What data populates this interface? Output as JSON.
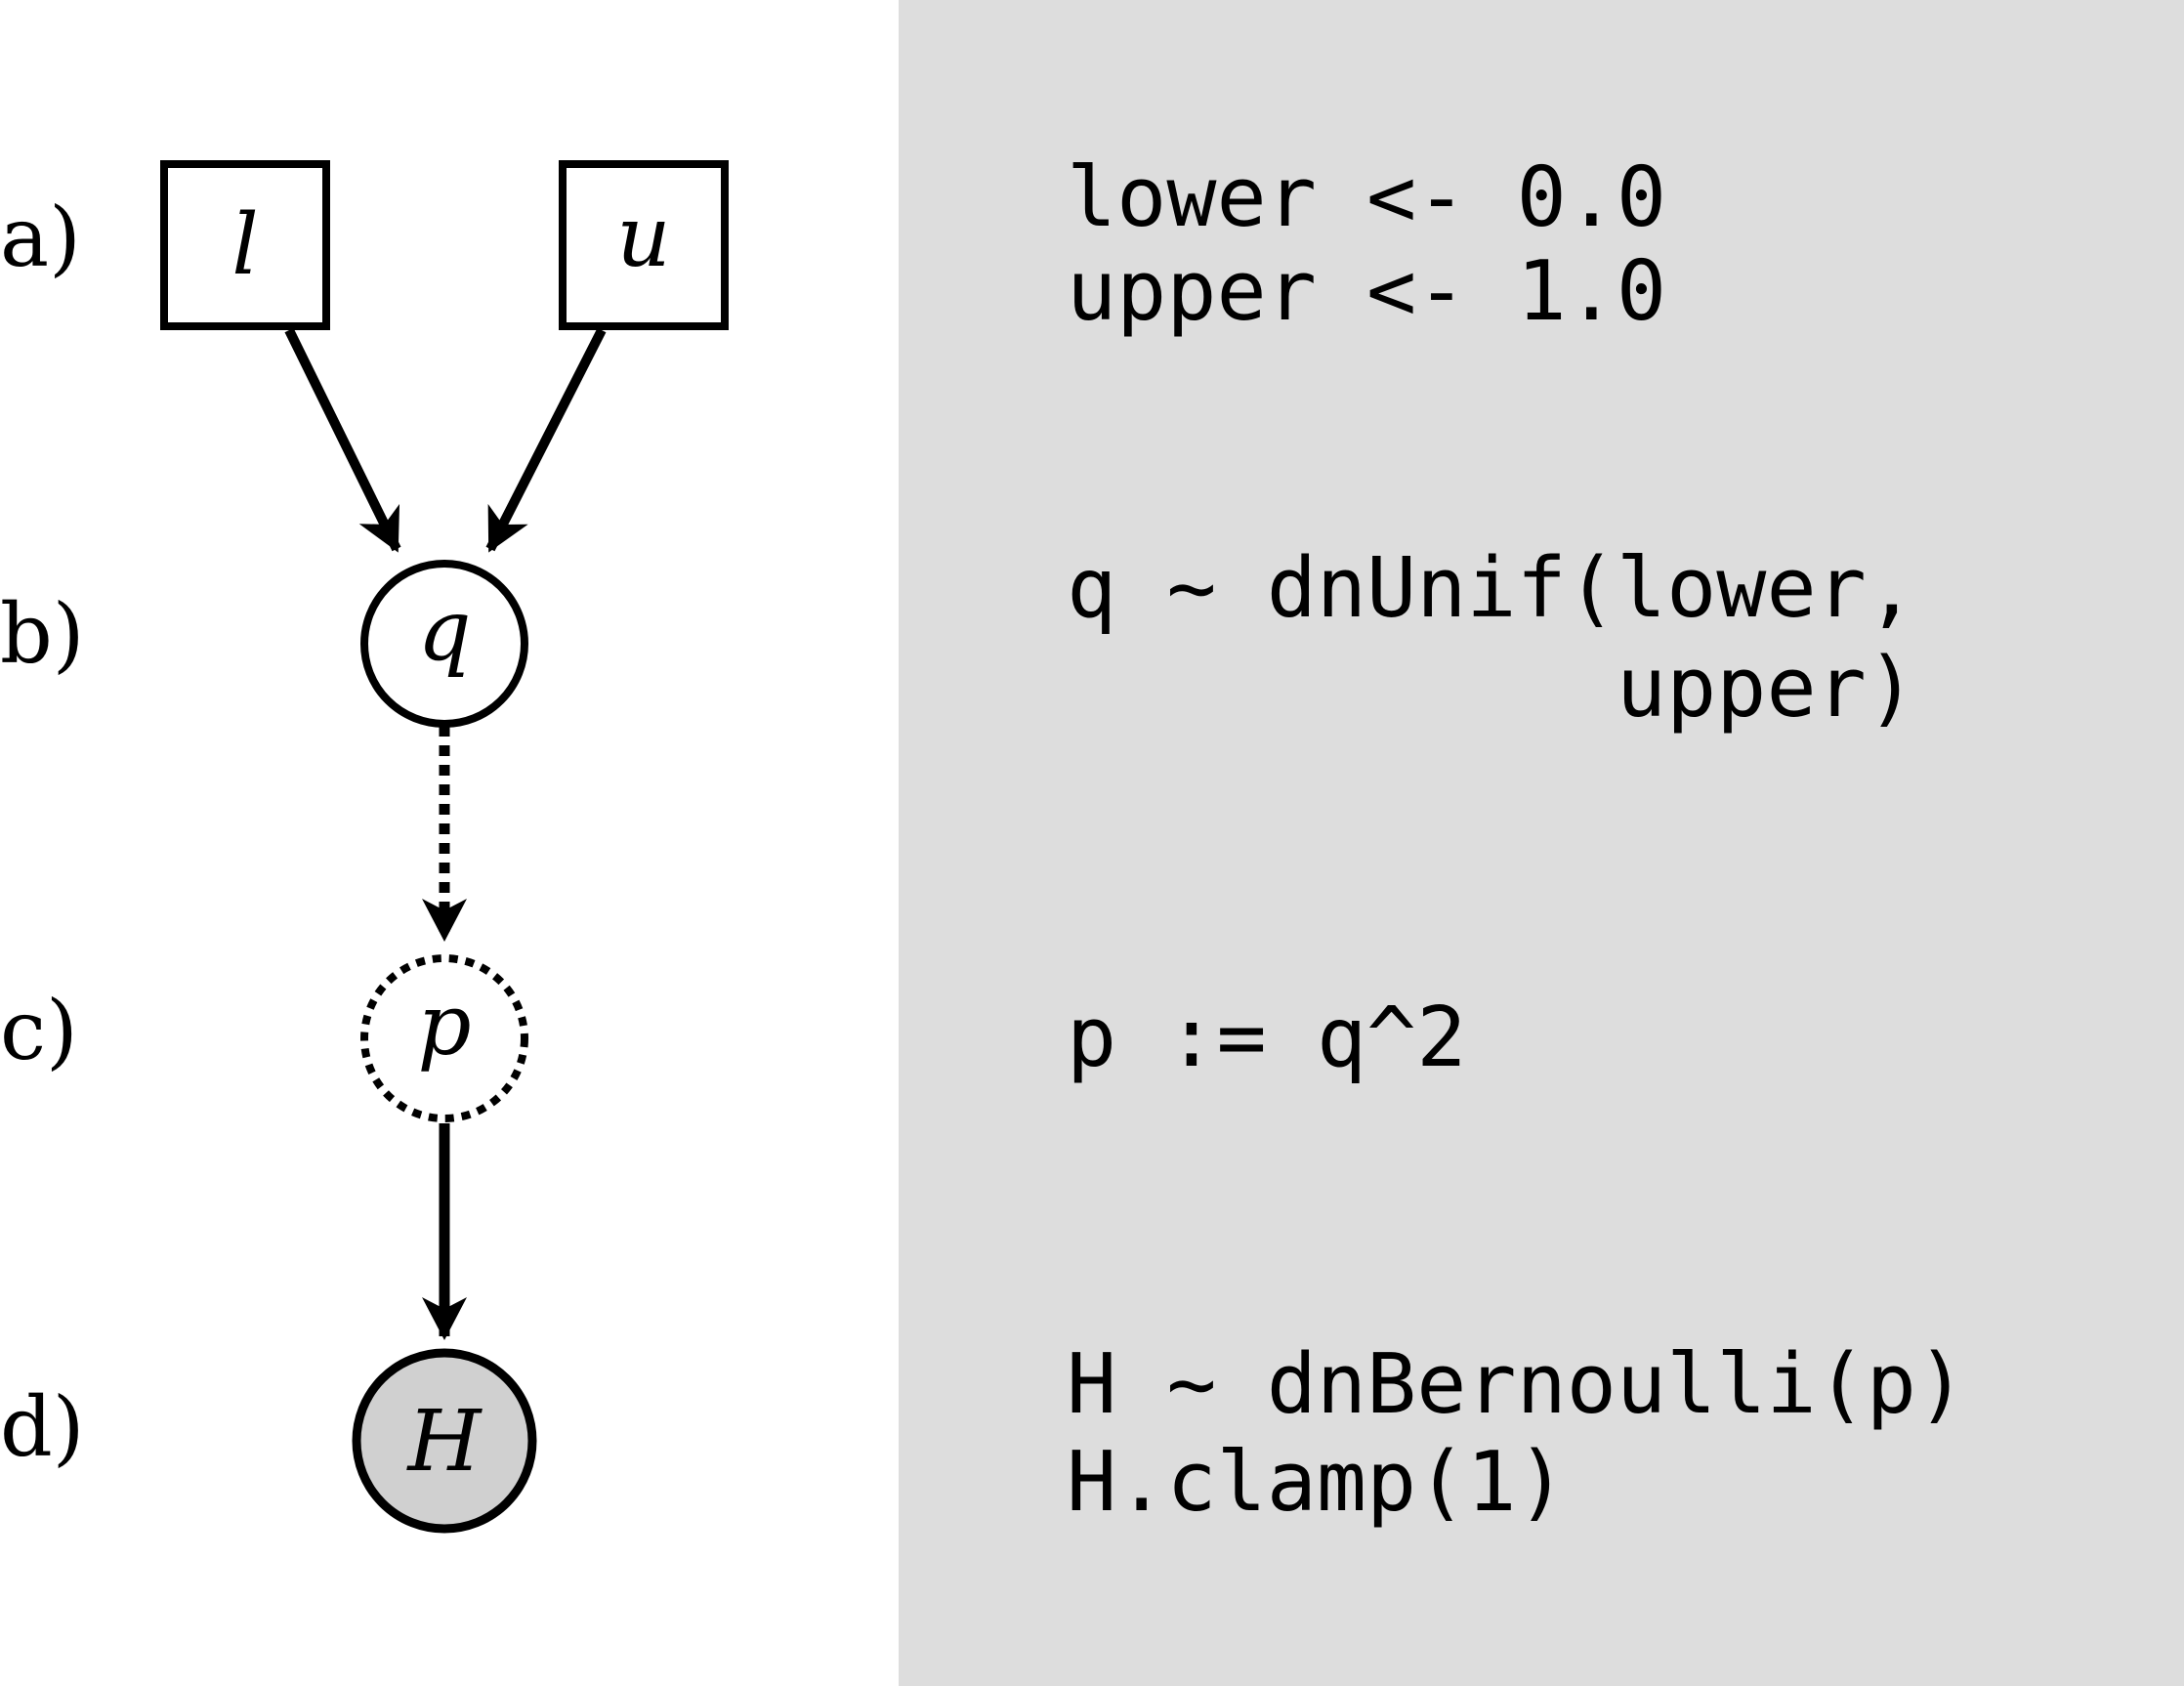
{
  "rows": [
    {
      "label": "a)"
    },
    {
      "label": "b)"
    },
    {
      "label": "c)"
    },
    {
      "label": "d)"
    }
  ],
  "nodes": {
    "l": {
      "label": "l",
      "kind": "constant"
    },
    "u": {
      "label": "u",
      "kind": "constant"
    },
    "q": {
      "label": "q",
      "kind": "stochastic"
    },
    "p": {
      "label": "p",
      "kind": "deterministic"
    },
    "H": {
      "label": "H",
      "kind": "clamped"
    }
  },
  "edges": [
    {
      "from": "l",
      "to": "q",
      "style": "solid"
    },
    {
      "from": "u",
      "to": "q",
      "style": "solid"
    },
    {
      "from": "q",
      "to": "p",
      "style": "dashed"
    },
    {
      "from": "p",
      "to": "H",
      "style": "solid"
    }
  ],
  "code": {
    "a": [
      "lower <- 0.0",
      "upper <- 1.0"
    ],
    "b": [
      "q ∼ dnUnif(lower,",
      "           upper)"
    ],
    "c": [
      "p := q^2"
    ],
    "d": [
      "H ∼ dnBernoulli(p)",
      "H.clamp(1)"
    ]
  },
  "colors": {
    "code_panel": "#dddddd",
    "clamped_fill": "#d0d0d0",
    "stroke": "#000000"
  }
}
